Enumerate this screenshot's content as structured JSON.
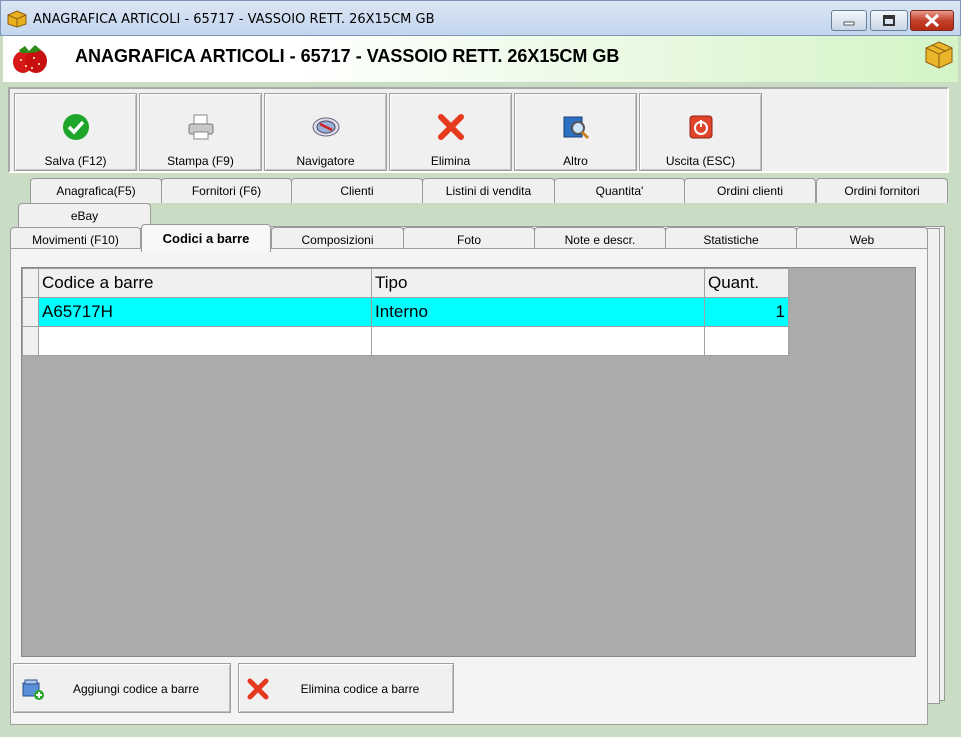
{
  "window": {
    "title": "ANAGRAFICA ARTICOLI - 65717 -  VASSOIO RETT. 26X15CM GB"
  },
  "header": {
    "title": "ANAGRAFICA ARTICOLI - 65717 -  VASSOIO RETT. 26X15CM GB"
  },
  "toolbar": {
    "save": "Salva (F12)",
    "print": "Stampa (F9)",
    "navigator": "Navigatore",
    "delete": "Elimina",
    "other": "Altro",
    "exit": "Uscita (ESC)"
  },
  "tabs_row1": [
    "Anagrafica(F5)",
    "Fornitori (F6)",
    "Clienti",
    "Listini di vendita",
    "Quantita'",
    "Ordini clienti",
    "Ordini fornitori"
  ],
  "tabs_row2": [
    "eBay"
  ],
  "tabs_row3": [
    "Movimenti (F10)",
    "Codici a barre",
    "Composizioni",
    "Foto",
    "Note e descr.",
    "Statistiche",
    "Web"
  ],
  "active_tab": "Codici a barre",
  "grid": {
    "headers": [
      "Codice a barre",
      "Tipo",
      "Quant."
    ],
    "rows": [
      {
        "code": "A65717H",
        "type": "Interno",
        "qty": "1"
      }
    ]
  },
  "buttons": {
    "add_barcode": "Aggiungi codice a barre",
    "delete_barcode": "Elimina codice a barre"
  },
  "colors": {
    "selected_row": "#00ffff",
    "window_bg": "#c9dcc4",
    "close_button": "#c4402a"
  }
}
